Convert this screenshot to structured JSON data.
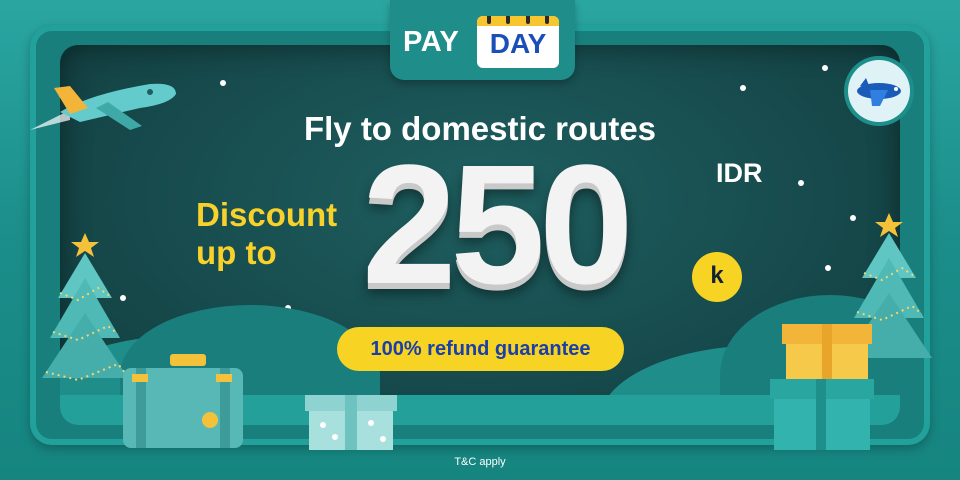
{
  "badge": {
    "pay": "PAY",
    "day": "DAY"
  },
  "headline": "Fly to domestic routes",
  "discount": {
    "line1": "Discount",
    "line2": "up to"
  },
  "amount": {
    "value": "250",
    "currency": "IDR",
    "suffix": "k"
  },
  "refund_label": "100% refund guarantee",
  "terms": "T&C apply",
  "colors": {
    "accent_yellow": "#f7d324",
    "teal": "#1f8d8a",
    "blue": "#1a4fb8"
  },
  "icons": [
    "airplane-icon",
    "airplane-badge-icon",
    "christmas-tree-icon",
    "suitcase-icon",
    "gift-box-icon"
  ]
}
